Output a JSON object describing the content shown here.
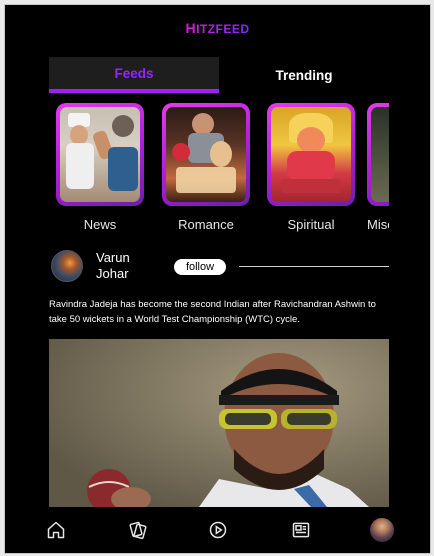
{
  "brand": {
    "mark": "H",
    "text": "ITZFEED"
  },
  "tabs": [
    {
      "label": "Feeds",
      "active": true
    },
    {
      "label": "Trending",
      "active": false
    }
  ],
  "categories": [
    {
      "label": "News"
    },
    {
      "label": "Romance"
    },
    {
      "label": "Spiritual"
    },
    {
      "label": "Miscellaneous"
    }
  ],
  "post": {
    "author": "Varun Johar",
    "follow_label": "follow",
    "headline": "Ravindra Jadeja has become the second Indian after Ravichandran Ashwin to take 50 wickets in a World Test Championship (WTC) cycle."
  },
  "bottom_nav": [
    {
      "icon": "home-icon"
    },
    {
      "icon": "cards-icon"
    },
    {
      "icon": "play-icon"
    },
    {
      "icon": "news-icon"
    },
    {
      "icon": "profile-avatar"
    }
  ],
  "colors": {
    "accent": "#a020f0",
    "frame_gradient_start": "#e33be8",
    "background": "#000000"
  }
}
